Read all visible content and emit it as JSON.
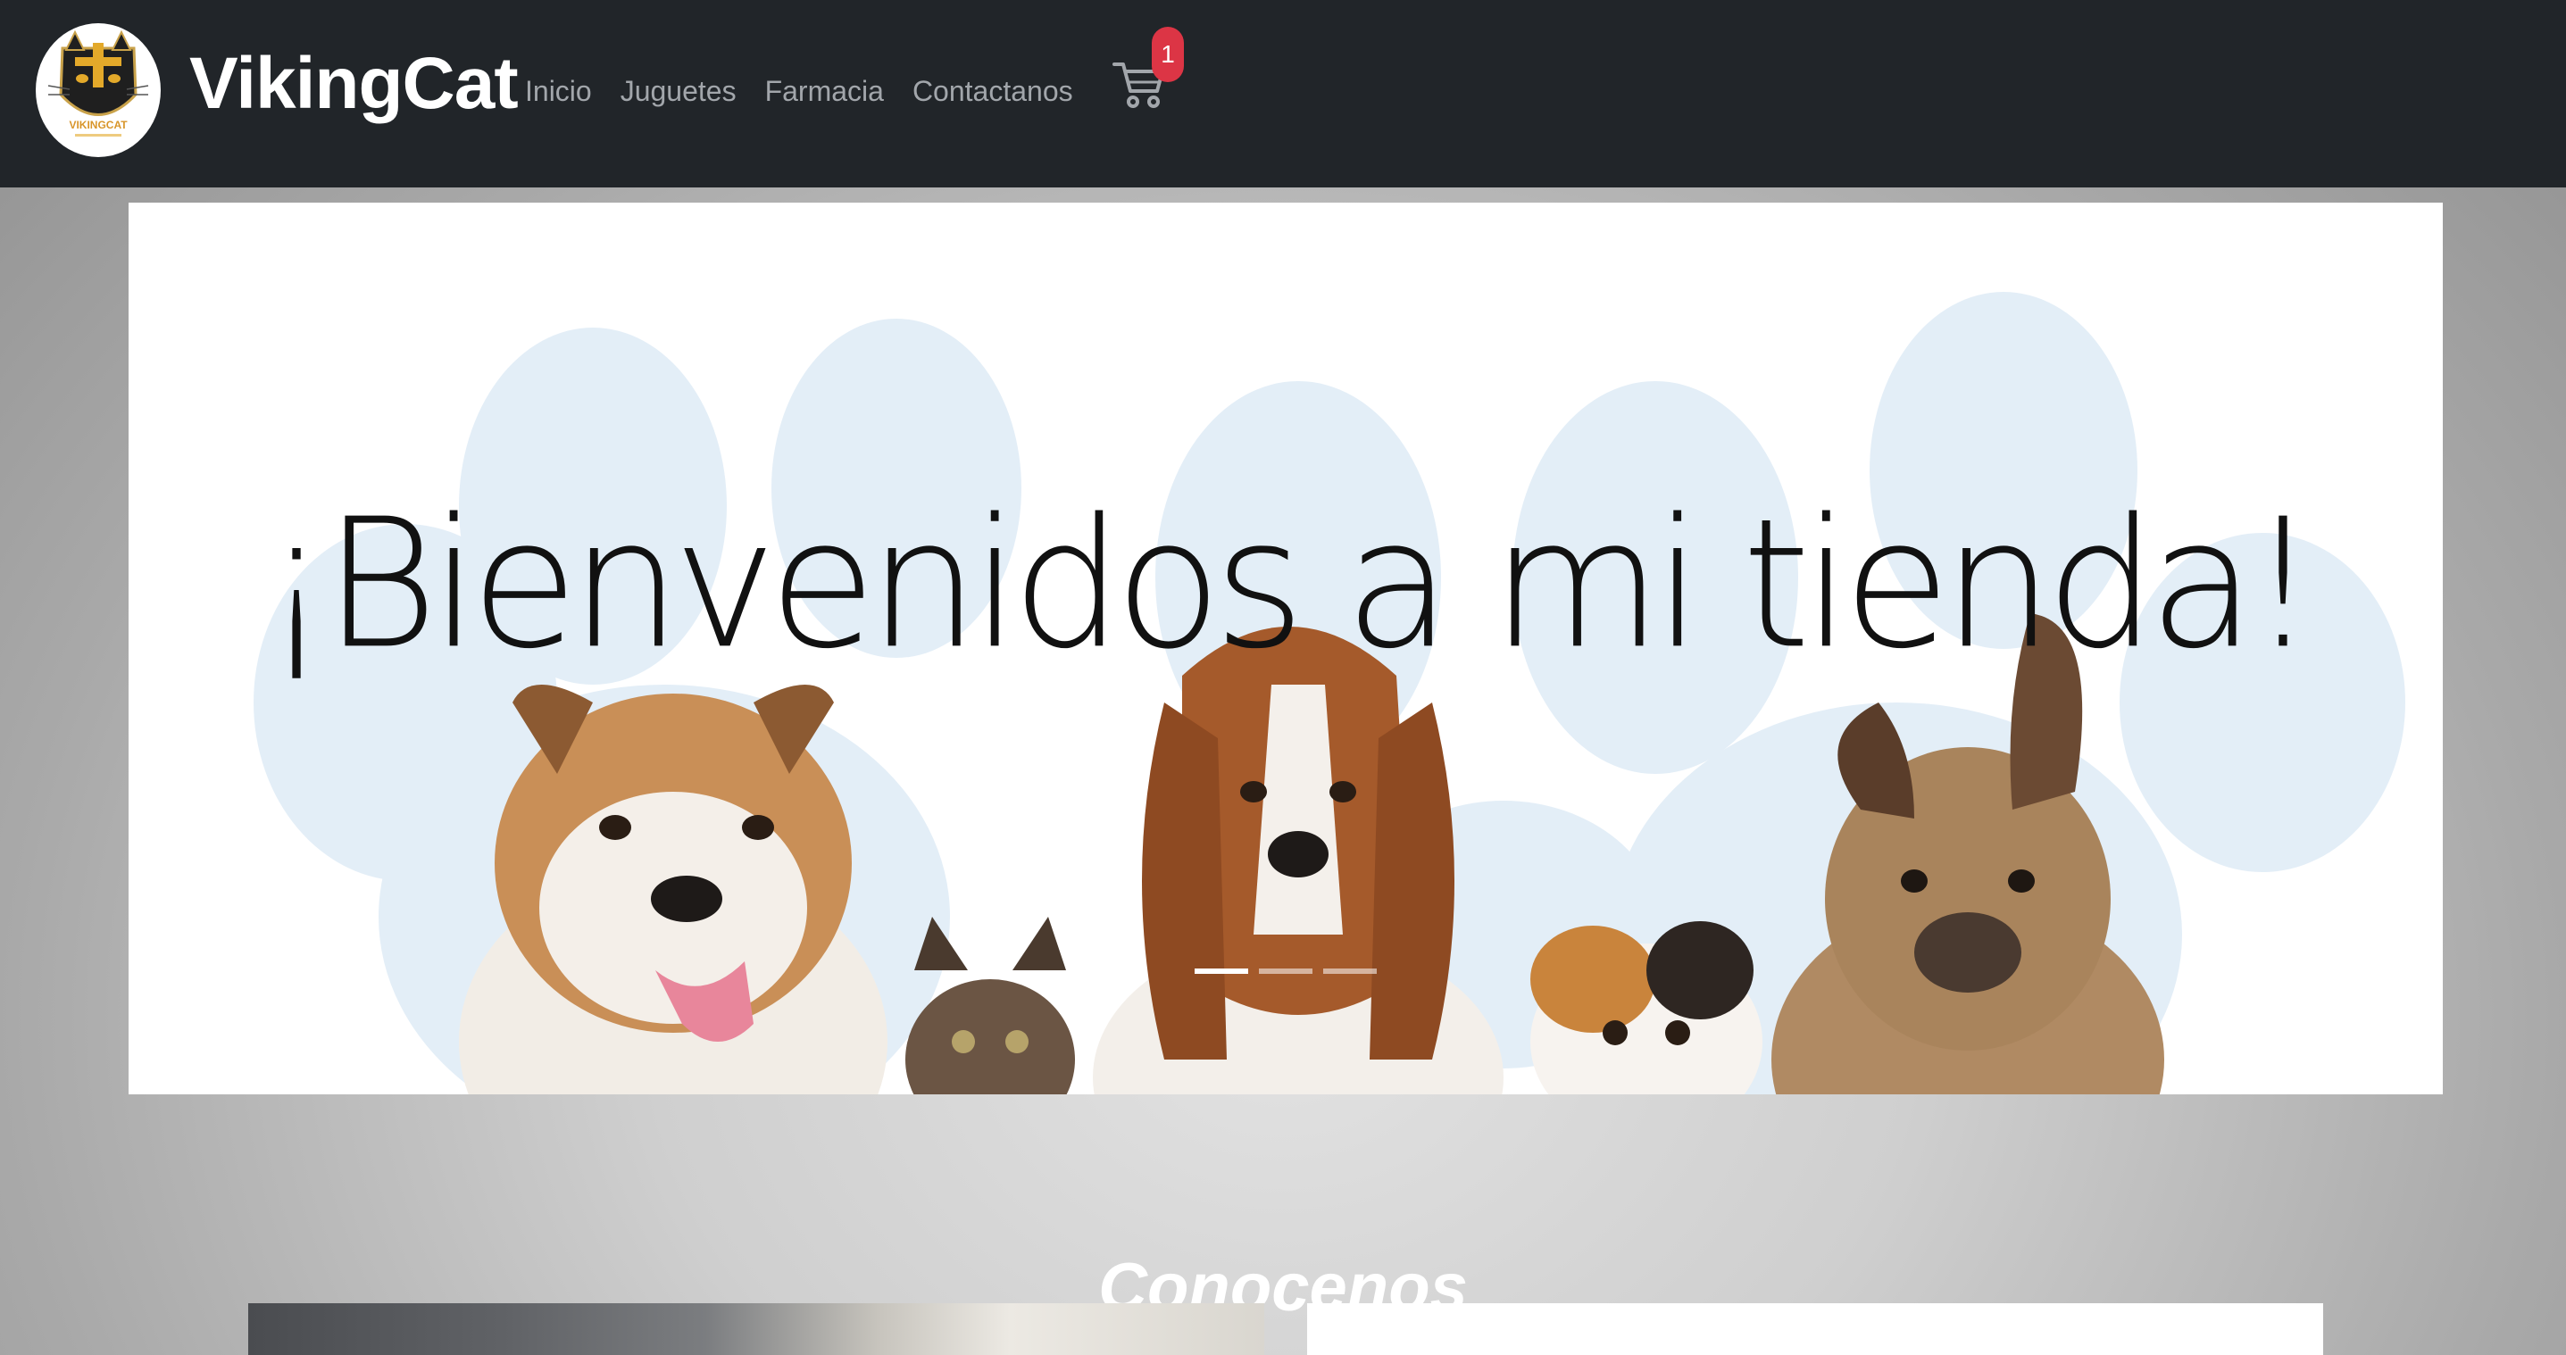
{
  "navbar": {
    "brand": "VikingCat",
    "logo_text": "VIKINGCAT",
    "logo_icon": "viking-cat-logo",
    "links": [
      {
        "label": "Inicio"
      },
      {
        "label": "Juguetes"
      },
      {
        "label": "Farmacia"
      },
      {
        "label": "Contactanos"
      }
    ],
    "cart_icon": "cart-icon",
    "cart_count": "1"
  },
  "carousel": {
    "heading": "¡Bienvenidos a mi tienda!",
    "slide_count": 3,
    "active_slide": 1
  },
  "section": {
    "title": "Conocenos"
  },
  "colors": {
    "navbar_bg": "#212529",
    "nav_link": "#a2a6ab",
    "badge": "#dc3545",
    "paw": "#e3eef7"
  }
}
